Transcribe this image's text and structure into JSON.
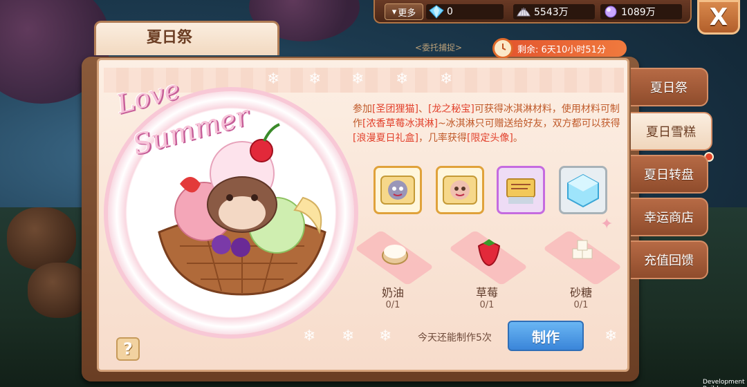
{
  "top_bar": {
    "more_label": "更多",
    "resources": [
      {
        "icon": "diamond-icon",
        "value": "0"
      },
      {
        "icon": "shell-icon",
        "value": "5543万"
      },
      {
        "icon": "pearl-icon",
        "value": "1089万"
      }
    ],
    "close_label": "X"
  },
  "event": {
    "title": "夏日祭",
    "subtitle": "<委托捕捉>",
    "timer_label": "剩余: 6天10小时51分",
    "love_text": "Love",
    "summer_text": "Summer",
    "description_parts": [
      {
        "text": "参加",
        "hl": false
      },
      {
        "text": "[圣团狸猫]",
        "hl": true
      },
      {
        "text": "、",
        "hl": false
      },
      {
        "text": "[龙之秘宝]",
        "hl": true
      },
      {
        "text": "可获得冰淇淋材料，使用材料可制作",
        "hl": false
      },
      {
        "text": "[浓香草莓冰淇淋]",
        "hl": true
      },
      {
        "text": "~冰淇淋只可赠送给好友，双方都可以获得",
        "hl": false
      },
      {
        "text": "[浪漫夏日礼盒]",
        "hl": true
      },
      {
        "text": "，几率获得",
        "hl": false
      },
      {
        "text": "[限定头像]",
        "hl": true
      },
      {
        "text": "。",
        "hl": false
      }
    ],
    "rewards": [
      {
        "name": "raccoon-avatar-frame-1",
        "frame": "gold"
      },
      {
        "name": "raccoon-avatar-frame-2",
        "frame": "gold"
      },
      {
        "name": "scroll-item",
        "frame": "purple"
      },
      {
        "name": "ice-cube-item",
        "frame": "silver"
      }
    ],
    "materials": [
      {
        "name": "奶油",
        "count": "0/1"
      },
      {
        "name": "草莓",
        "count": "0/1"
      },
      {
        "name": "砂糖",
        "count": "0/1"
      }
    ],
    "today_label": "今天还能制作5次",
    "make_label": "制作",
    "help_label": "?"
  },
  "side_tabs": [
    {
      "label": "夏日祭",
      "active": false
    },
    {
      "label": "夏日雪糕",
      "active": true
    },
    {
      "label": "夏日转盘",
      "active": false
    },
    {
      "label": "幸运商店",
      "active": false
    },
    {
      "label": "充值回馈",
      "active": false
    }
  ],
  "footer": {
    "dev_build": "Development Build"
  },
  "colors": {
    "accent": "#e2452a",
    "button_blue": "#3a85d9",
    "tab_brown": "#8f4c2c",
    "text_orange": "#c05a2a"
  }
}
